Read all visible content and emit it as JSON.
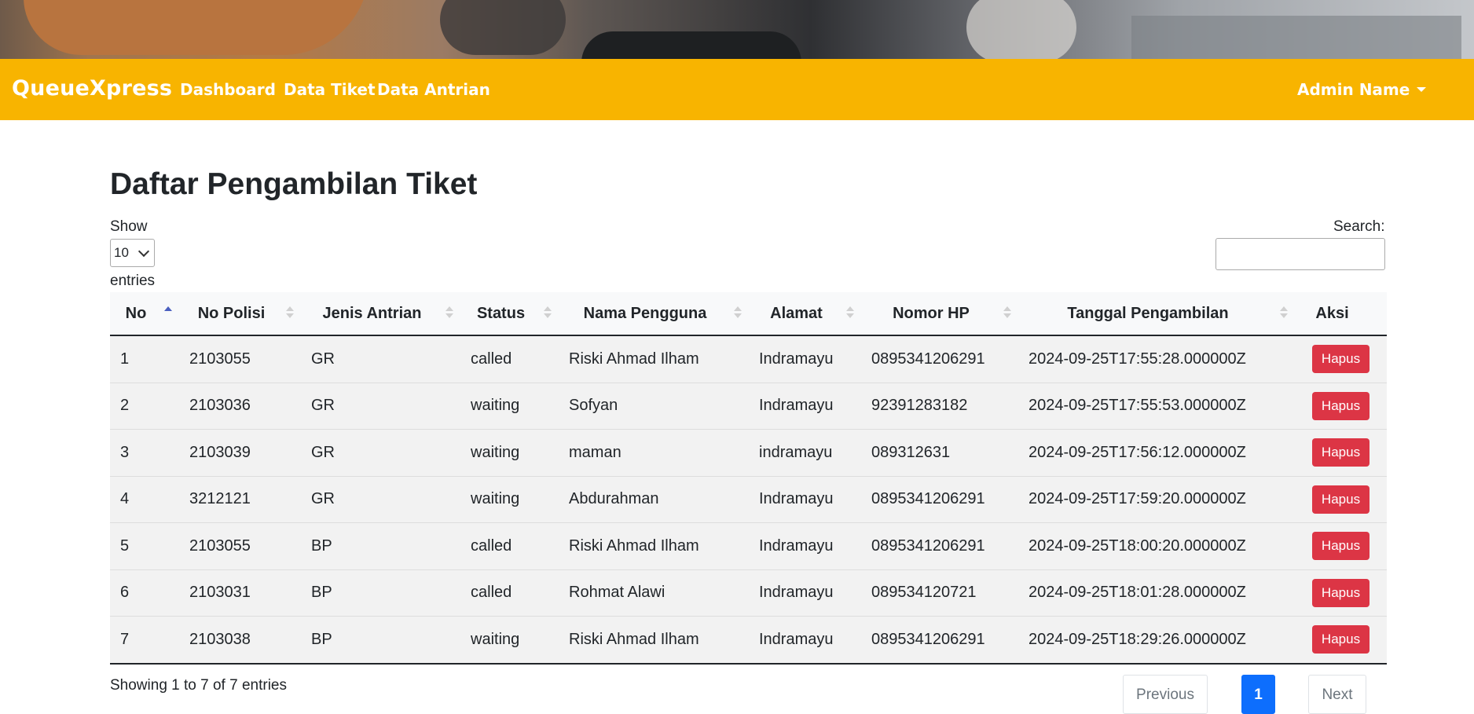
{
  "navbar": {
    "brand": "QueueXpress",
    "links": [
      "Dashboard",
      "Data Tiket",
      "Data Antrian"
    ],
    "user": "Admin Name"
  },
  "page": {
    "title": "Daftar Pengambilan Tiket",
    "show_label": "Show",
    "page_length": "10",
    "entries_label": "entries",
    "search_label": "Search:",
    "search_value": ""
  },
  "table": {
    "columns": [
      "No",
      "No Polisi",
      "Jenis Antrian",
      "Status",
      "Nama Pengguna",
      "Alamat",
      "Nomor HP",
      "Tanggal Pengambilan",
      "Aksi"
    ],
    "sorted_column": "No",
    "sort_direction": "ascending",
    "action_label": "Hapus",
    "rows": [
      [
        "1",
        "2103055",
        "GR",
        "called",
        "Riski Ahmad Ilham",
        "Indramayu",
        "0895341206291",
        "2024-09-25T17:55:28.000000Z"
      ],
      [
        "2",
        "2103036",
        "GR",
        "waiting",
        "Sofyan",
        "Indramayu",
        "92391283182",
        "2024-09-25T17:55:53.000000Z"
      ],
      [
        "3",
        "2103039",
        "GR",
        "waiting",
        "maman",
        "indramayu",
        "089312631",
        "2024-09-25T17:56:12.000000Z"
      ],
      [
        "4",
        "3212121",
        "GR",
        "waiting",
        "Abdurahman",
        "Indramayu",
        "0895341206291",
        "2024-09-25T17:59:20.000000Z"
      ],
      [
        "5",
        "2103055",
        "BP",
        "called",
        "Riski Ahmad Ilham",
        "Indramayu",
        "0895341206291",
        "2024-09-25T18:00:20.000000Z"
      ],
      [
        "6",
        "2103031",
        "BP",
        "called",
        "Rohmat Alawi",
        "Indramayu",
        "089534120721",
        "2024-09-25T18:01:28.000000Z"
      ],
      [
        "7",
        "2103038",
        "BP",
        "waiting",
        "Riski Ahmad Ilham",
        "Indramayu",
        "0895341206291",
        "2024-09-25T18:29:26.000000Z"
      ]
    ]
  },
  "footer": {
    "info": "Showing 1 to 7 of 7 entries",
    "previous": "Previous",
    "current_page": "1",
    "next": "Next"
  },
  "colors": {
    "navbar": "#f8b400",
    "delete_button": "#dc3545",
    "current_page": "#0d6efd"
  }
}
